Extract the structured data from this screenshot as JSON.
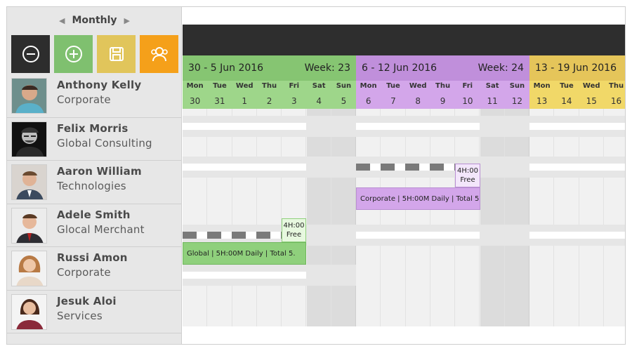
{
  "period": {
    "label": "Monthly",
    "prev_icon": "arrow-left-icon",
    "next_icon": "arrow-right-icon"
  },
  "toolbar": [
    {
      "name": "zoom-out-button",
      "icon": "minus-circle-icon",
      "color": "#2d2d2d"
    },
    {
      "name": "zoom-in-button",
      "icon": "plus-circle-icon",
      "color": "#7fc06f"
    },
    {
      "name": "save-button",
      "icon": "floppy-disk-icon",
      "color": "#e1c55b"
    },
    {
      "name": "users-button",
      "icon": "users-icon",
      "color": "#f5a01a"
    }
  ],
  "people": [
    {
      "name": "Anthony Kelly",
      "company": "Corporate"
    },
    {
      "name": "Felix Morris",
      "company": "Global Consulting"
    },
    {
      "name": "Aaron William",
      "company": "Technologies"
    },
    {
      "name": "Adele Smith",
      "company": "Glocal Merchant"
    },
    {
      "name": "Russi Amon",
      "company": "Corporate"
    },
    {
      "name": "Jesuk Aloi",
      "company": "Services"
    }
  ],
  "weeks": [
    {
      "range": "30 - 5 Jun 2016",
      "week": "Week: 23",
      "color": "#86c572",
      "day_color": "#9ed68a",
      "days": [
        "Mon",
        "Tue",
        "Wed",
        "Thu",
        "Fri",
        "Sat",
        "Sun"
      ],
      "dates": [
        "30",
        "31",
        "1",
        "2",
        "3",
        "4",
        "5"
      ]
    },
    {
      "range": "6 - 12 Jun 2016",
      "week": "Week: 24",
      "color": "#c08fdb",
      "day_color": "#d3a6ea",
      "days": [
        "Mon",
        "Tue",
        "Wed",
        "Thu",
        "Fri",
        "Sat",
        "Sun"
      ],
      "dates": [
        "6",
        "7",
        "8",
        "9",
        "10",
        "11",
        "12"
      ]
    },
    {
      "range": "13 - 19 Jun 2016",
      "week": "",
      "color": "#e5c55a",
      "day_color": "#f1d868",
      "days": [
        "Mon",
        "Tue",
        "Wed",
        "Thu"
      ],
      "dates": [
        "13",
        "14",
        "15",
        "16"
      ]
    }
  ],
  "tasks": [
    {
      "label": "Corporate | 5H:00M Daily | Total 5.",
      "color": "#d3a6ea"
    },
    {
      "label": "Global | 5H:00M Daily | Total 5.",
      "color": "#8fd07c"
    }
  ],
  "free_slots": [
    {
      "line1": "4H:00",
      "line2": "Free",
      "color": "#f3e6fb"
    },
    {
      "line1": "4H:00",
      "line2": "Free",
      "color": "#e7f8df"
    }
  ],
  "colors": {
    "top_bar": "#2e2e2e",
    "weekend_shade": "#dcdcdc",
    "dash": "#7a7a7a"
  }
}
